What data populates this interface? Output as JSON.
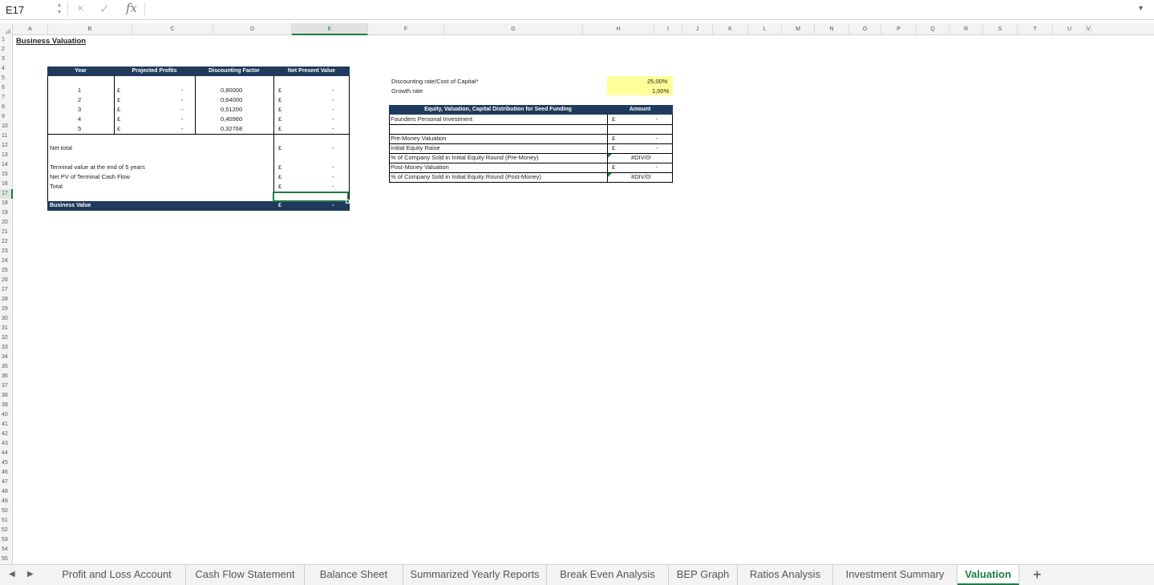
{
  "formula_bar": {
    "cell_ref": "E17",
    "cancel_icon": "×",
    "confirm_icon": "✓",
    "fx": "fx",
    "formula": ""
  },
  "columns": [
    "A",
    "B",
    "C",
    "D",
    "E",
    "F",
    "G",
    "H",
    "I",
    "J",
    "K",
    "L",
    "M",
    "N",
    "O",
    "P",
    "Q",
    "R",
    "S",
    "T",
    "U",
    "V"
  ],
  "active_column": "E",
  "rows": [
    "1",
    "2",
    "3",
    "4",
    "5",
    "6",
    "7",
    "8",
    "9",
    "10",
    "11",
    "12",
    "13",
    "14",
    "15",
    "16",
    "17",
    "18",
    "19",
    "20",
    "21",
    "22",
    "23",
    "24",
    "25",
    "26",
    "27",
    "28",
    "29",
    "30",
    "31",
    "32",
    "33",
    "34",
    "35",
    "36",
    "37",
    "38",
    "39",
    "40",
    "41",
    "42",
    "43",
    "44",
    "45",
    "46",
    "47",
    "48",
    "49",
    "50",
    "51",
    "52",
    "53",
    "54",
    "55"
  ],
  "active_row": "17",
  "sheet": {
    "title": "Business Valuation",
    "bv_table": {
      "headers": [
        "Year",
        "Projected Profits",
        "Discounting Factor",
        "Net Present Value"
      ],
      "rows": [
        {
          "year": "1",
          "cur": "£",
          "profit": "-",
          "factor": "0,80000",
          "cur2": "£",
          "npv": "-"
        },
        {
          "year": "2",
          "cur": "£",
          "profit": "-",
          "factor": "0,64000",
          "cur2": "£",
          "npv": "-"
        },
        {
          "year": "3",
          "cur": "£",
          "profit": "-",
          "factor": "0,51200",
          "cur2": "£",
          "npv": "-"
        },
        {
          "year": "4",
          "cur": "£",
          "profit": "-",
          "factor": "0,40960",
          "cur2": "£",
          "npv": "-"
        },
        {
          "year": "5",
          "cur": "£",
          "profit": "-",
          "factor": "0,32768",
          "cur2": "£",
          "npv": "-"
        }
      ],
      "net_total": {
        "label": "Net total",
        "cur": "£",
        "value": "-"
      },
      "terminal_value": {
        "label": "Terminal value at the end of 5 years",
        "cur": "£",
        "value": "-"
      },
      "net_pv_terminal": {
        "label": "Net PV of Terminal Cash Flow",
        "cur": "£",
        "value": "-"
      },
      "total": {
        "label": "Total",
        "cur": "£",
        "value": "-"
      },
      "business_value": {
        "label": "Business Value",
        "cur": "£",
        "value": "-"
      }
    },
    "params": {
      "discount_label": "Discounting rate/Cost of Capital*",
      "discount_value": "25,00%",
      "growth_label": "Growth rate",
      "growth_value": "1,00%"
    },
    "equity_table": {
      "header_label": "Equity, Valuation, Capital Distribution for Seed Funding",
      "header_amount": "Amount",
      "founders": {
        "label": "Founders Personal Investment",
        "cur": "£",
        "value": "-"
      },
      "pre_money": {
        "label": "Pre-Money Valuation",
        "cur": "£",
        "value": "-"
      },
      "initial_raise": {
        "label": "Initial Equity Raise",
        "cur": "£",
        "value": "-"
      },
      "pct_pre": {
        "label": "% of Company Sold in Initial Equity Round (Pre-Money)",
        "value": "#DIV/0!"
      },
      "post_money": {
        "label": "Post-Money Valuation",
        "cur": "£",
        "value": "-"
      },
      "pct_post": {
        "label": "% of Company Sold in Initial Equity Round (Post-Money)",
        "value": "#DIV/0!"
      }
    }
  },
  "tabs": [
    "Profit and Loss Account",
    "Cash Flow Statement",
    "Balance Sheet",
    "Summarized Yearly Reports",
    "Break Even Analysis",
    "BEP Graph",
    "Ratios Analysis",
    "Investment Summary",
    "Valuation"
  ],
  "active_tab": "Valuation",
  "add_tab": "+",
  "nav_prev": "◀",
  "nav_next": "▶",
  "accent_color": "#1f7a45",
  "header_fill": "#1f3a5c",
  "input_fill": "#ffff99"
}
